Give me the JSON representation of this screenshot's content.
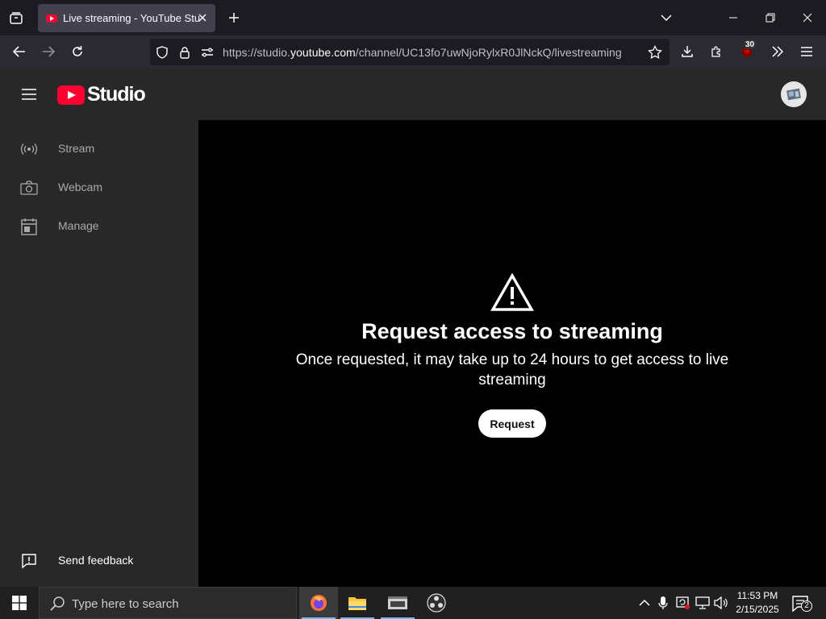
{
  "browser": {
    "tab_title": "Live streaming - YouTube Studio",
    "url_prefix": "https://studio.",
    "url_host": "youtube.com",
    "url_path": "/channel/UC13fo7uwNjoRylxR0JlNckQ/livestreaming",
    "extension_badge": "30"
  },
  "header": {
    "logo_text": "Studio"
  },
  "sidebar": {
    "items": [
      {
        "label": "Stream",
        "icon": "broadcast-icon"
      },
      {
        "label": "Webcam",
        "icon": "camera-icon"
      },
      {
        "label": "Manage",
        "icon": "calendar-icon"
      }
    ],
    "feedback_label": "Send feedback"
  },
  "main": {
    "title": "Request access to streaming",
    "subtitle": "Once requested, it may take up to 24 hours to get access to live streaming",
    "button_label": "Request"
  },
  "taskbar": {
    "search_placeholder": "Type here to search",
    "time": "11:53 PM",
    "date": "2/15/2025",
    "notification_count": "2"
  },
  "colors": {
    "brand_red": "#ff0033",
    "sidebar_bg": "#282828",
    "main_bg": "#000000"
  }
}
